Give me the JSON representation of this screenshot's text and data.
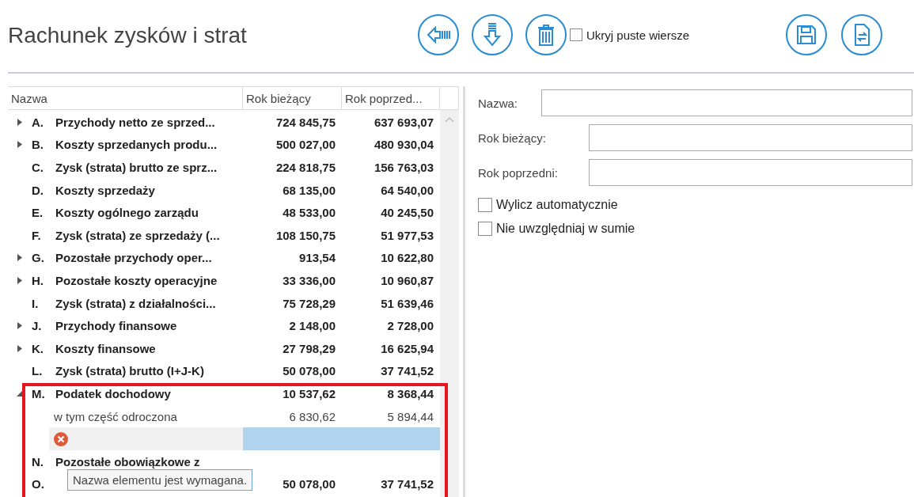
{
  "title": "Rachunek zysków i strat",
  "toolbar": {
    "hide_empty": {
      "label": "Ukryj puste wiersze",
      "checked": false
    }
  },
  "table": {
    "columns": [
      "Nazwa",
      "Rok bieżący",
      "Rok poprzed..."
    ],
    "rows": [
      {
        "kind": "group",
        "expanded": false,
        "marker": "A.",
        "label": "Przychody netto ze sprzed...",
        "current": "724 845,75",
        "previous": "637 693,07"
      },
      {
        "kind": "group",
        "expanded": false,
        "marker": "B.",
        "label": "Koszty sprzedanych produ...",
        "current": "500 027,00",
        "previous": "480 930,04"
      },
      {
        "kind": "leaf",
        "marker": "C.",
        "label": "Zysk (strata) brutto ze sprz...",
        "current": "224 818,75",
        "previous": "156 763,03"
      },
      {
        "kind": "leaf",
        "marker": "D.",
        "label": "Koszty sprzedaży",
        "current": "68 135,00",
        "previous": "64 540,00"
      },
      {
        "kind": "leaf",
        "marker": "E.",
        "label": "Koszty ogólnego zarządu",
        "current": "48 533,00",
        "previous": "40 245,50"
      },
      {
        "kind": "leaf",
        "marker": "F.",
        "label": "Zysk (strata) ze sprzedaży (...",
        "current": "108 150,75",
        "previous": "51 977,53"
      },
      {
        "kind": "group",
        "expanded": false,
        "marker": "G.",
        "label": "Pozostałe przychody oper...",
        "current": "913,54",
        "previous": "10 622,80"
      },
      {
        "kind": "group",
        "expanded": false,
        "marker": "H.",
        "label": "Pozostałe koszty operacyjne",
        "current": "33 336,00",
        "previous": "10 960,87"
      },
      {
        "kind": "leaf",
        "marker": "I.",
        "label": "Zysk (strata) z działalności...",
        "current": "75 728,29",
        "previous": "51 639,46"
      },
      {
        "kind": "group",
        "expanded": false,
        "marker": "J.",
        "label": "Przychody finansowe",
        "current": "2 148,00",
        "previous": "2 728,00"
      },
      {
        "kind": "group",
        "expanded": false,
        "marker": "K.",
        "label": "Koszty finansowe",
        "current": "27 798,29",
        "previous": "16 625,94"
      },
      {
        "kind": "leaf",
        "marker": "L.",
        "label": "Zysk (strata) brutto (I+J-K)",
        "current": "50 078,00",
        "previous": "37 741,52"
      },
      {
        "kind": "group",
        "expanded": true,
        "marker": "M.",
        "label": "Podatek dochodowy",
        "current": "10 537,62",
        "previous": "8 368,44"
      },
      {
        "kind": "sub",
        "label": "w tym część odroczona",
        "current": "6 830,62",
        "previous": "5 894,44"
      },
      {
        "kind": "error"
      },
      {
        "kind": "leaf",
        "marker": "N.",
        "label": "Pozostałe obowiązkowe z"
      },
      {
        "kind": "leaf",
        "marker": "O.",
        "current": "50 078,00",
        "previous": "37 741,52"
      }
    ],
    "tooltip": "Nazwa elementu jest wymagana."
  },
  "form": {
    "fields": [
      {
        "label": "Nazwa:"
      },
      {
        "label": "Rok bieżący:"
      },
      {
        "label": "Rok poprzedni:"
      }
    ],
    "checkboxes": [
      {
        "label": "Wylicz automatycznie",
        "checked": false
      },
      {
        "label": "Nie uwzględniaj w sumie",
        "checked": false
      }
    ]
  }
}
